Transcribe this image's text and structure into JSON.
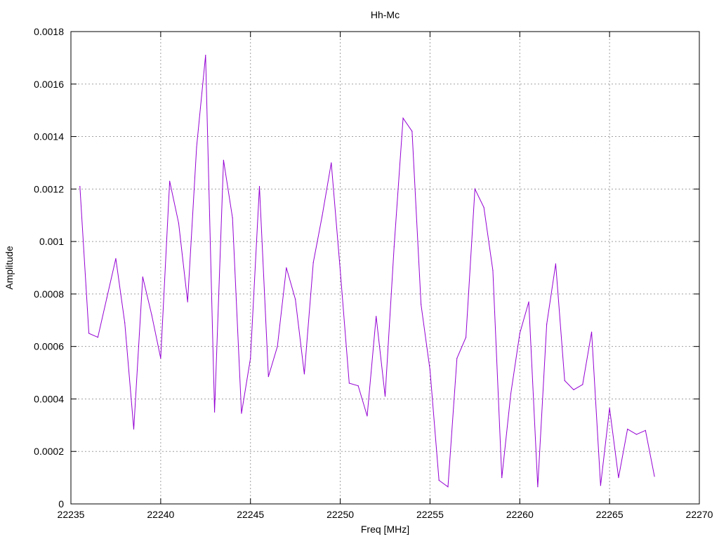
{
  "chart_data": {
    "type": "line",
    "title": "Hh-Mc",
    "xlabel": "Freq [MHz]",
    "ylabel": "Amplitude",
    "xlim": [
      22235,
      22270
    ],
    "ylim": [
      0,
      0.0018
    ],
    "x_ticks": [
      22235,
      22240,
      22245,
      22250,
      22255,
      22260,
      22265,
      22270
    ],
    "y_ticks": [
      0,
      0.0002,
      0.0004,
      0.0006,
      0.0008,
      0.001,
      0.0012,
      0.0014,
      0.0016,
      0.0018
    ],
    "y_tick_labels": [
      "0",
      "0.0002",
      "0.0004",
      "0.0006",
      "0.0008",
      "0.001",
      "0.0012",
      "0.0014",
      "0.0016",
      "0.0018"
    ],
    "grid": true,
    "line_color": "#9400d3",
    "series": [
      {
        "x": [
          22235.5,
          22236.0,
          22236.5,
          22237.0,
          22237.5,
          22238.0,
          22238.5,
          22239.0,
          22239.5,
          22240.0,
          22240.5,
          22241.0,
          22241.5,
          22242.0,
          22242.5,
          22243.0,
          22243.5,
          22244.0,
          22244.5,
          22245.0,
          22245.5,
          22246.0,
          22246.5,
          22247.0,
          22247.5,
          22248.0,
          22248.5,
          22249.0,
          22249.5,
          22250.0,
          22250.5,
          22251.0,
          22251.5,
          22252.0,
          22252.5,
          22253.0,
          22253.5,
          22254.0,
          22254.5,
          22255.0,
          22255.5,
          22256.0,
          22256.5,
          22257.0,
          22257.5,
          22258.0,
          22258.5,
          22259.0,
          22259.5,
          22260.0,
          22260.5,
          22261.0,
          22261.5,
          22262.0,
          22262.5,
          22263.0,
          22263.5,
          22264.0,
          22264.5,
          22265.0,
          22265.5,
          22266.0,
          22266.5,
          22267.0,
          22267.5
        ],
        "values": [
          0.00121,
          0.00065,
          0.000635,
          0.000785,
          0.000935,
          0.00069,
          0.000285,
          0.000865,
          0.00072,
          0.000555,
          0.00123,
          0.00107,
          0.00077,
          0.00136,
          0.00171,
          0.00035,
          0.00131,
          0.00109,
          0.000345,
          0.000555,
          0.00121,
          0.000485,
          0.0006,
          0.0009,
          0.00078,
          0.000495,
          0.00092,
          0.0011,
          0.0013,
          0.00089,
          0.00046,
          0.00045,
          0.000335,
          0.000715,
          0.00041,
          0.00098,
          0.00147,
          0.00142,
          0.00076,
          0.00051,
          9e-05,
          6.5e-05,
          0.000555,
          0.000635,
          0.0012,
          0.00113,
          0.00089,
          0.0001,
          0.00042,
          0.00065,
          0.00077,
          6.5e-05,
          0.000685,
          0.000915,
          0.00047,
          0.000435,
          0.000455,
          0.000655,
          7e-05,
          0.000365,
          0.0001,
          0.000285,
          0.000265,
          0.00028,
          0.000105
        ]
      }
    ]
  }
}
